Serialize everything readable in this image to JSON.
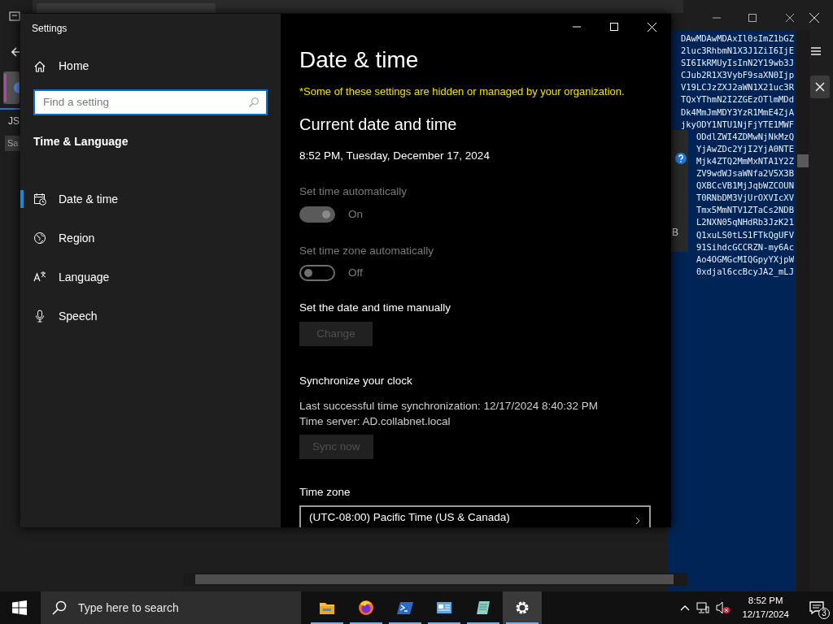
{
  "background_app": {
    "editor_lines": [
      "DAwMDAwMDAxIl0sImZ1bGZ",
      "2luc3RhbmN1X3J1ZiI6IjE",
      "SI6IkRMUyIsInN2Y19wb3J",
      "CJub2R1X3VybF9saXN0Ijp",
      "V19LCJzZXJ2aWN1X21uc3R",
      "TQxYThmN2I2ZGEzOTlmMDd",
      "Dk4MmJmMDY3YzR1MmE4ZjA",
      "jkyODY1NTU1NjFjYTE1MWF",
      "ODdlZWI4ZDMwNjNkMzQ",
      "YjAwZDc2YjI2YjA0NTE",
      "Mjk4ZTQ2MmMxNTA1Y2Z",
      "ZV9wdWJsaWNfa2V5X3B",
      "QXBCcVB1MjJqbWZCOUN",
      "T0RNbDM3VjUrOXVIcXV",
      "Tmx5MmNTV1ZTaCs2NDB",
      "L2NXN05qNHdRb3JzK21",
      "Q1xuLS0tLS1FTkQgUFV",
      "91SihdcGCCRZN-my6Ac",
      "Ao4OGMGcMIQGpyYXjpW",
      "0xdjal6ccBcyJA2_mLJ"
    ],
    "left_tab": "JS",
    "left_button": "Sa",
    "side_letter": "B"
  },
  "settings": {
    "title": "Settings",
    "home": "Home",
    "search": {
      "placeholder": "Find a setting"
    },
    "section": "Time & Language",
    "nav": [
      {
        "kind": "datetime",
        "label": "Date & time",
        "selected": true
      },
      {
        "kind": "region",
        "label": "Region",
        "selected": false
      },
      {
        "kind": "language",
        "label": "Language",
        "selected": false
      },
      {
        "kind": "speech",
        "label": "Speech",
        "selected": false
      }
    ],
    "page": {
      "title": "Date & time",
      "notice": "*Some of these settings are hidden or managed by your organization.",
      "heading": "Current date and time",
      "current": "8:52 PM, Tuesday, December 17, 2024",
      "toggles": [
        {
          "label": "Set time automatically",
          "on": true,
          "state_text": "On",
          "disabled": true
        },
        {
          "label": "Set time zone automatically",
          "on": false,
          "state_text": "Off",
          "disabled": true
        }
      ],
      "manual_label": "Set the date and time manually",
      "change_button": {
        "label": "Change",
        "disabled": true
      },
      "sync_heading": "Synchronize your clock",
      "sync_lines": [
        "Last successful time synchronization: 12/17/2024 8:40:32 PM",
        "Time server: AD.collabnet.local"
      ],
      "sync_button": {
        "label": "Sync now",
        "disabled": true
      },
      "timezone_label": "Time zone",
      "timezone_value": "(UTC-08:00) Pacific Time (US & Canada)"
    }
  },
  "taskbar": {
    "search": {
      "placeholder": "Type here to search"
    },
    "apps": [
      {
        "kind": "folder",
        "selected": false
      },
      {
        "kind": "browser",
        "selected": false
      },
      {
        "kind": "terminal",
        "selected": false
      },
      {
        "kind": "network",
        "selected": false
      },
      {
        "kind": "notepad",
        "selected": false
      },
      {
        "kind": "settings",
        "selected": true
      }
    ],
    "time": "8:52 PM",
    "date": "12/17/2024",
    "notification_count": "3"
  }
}
